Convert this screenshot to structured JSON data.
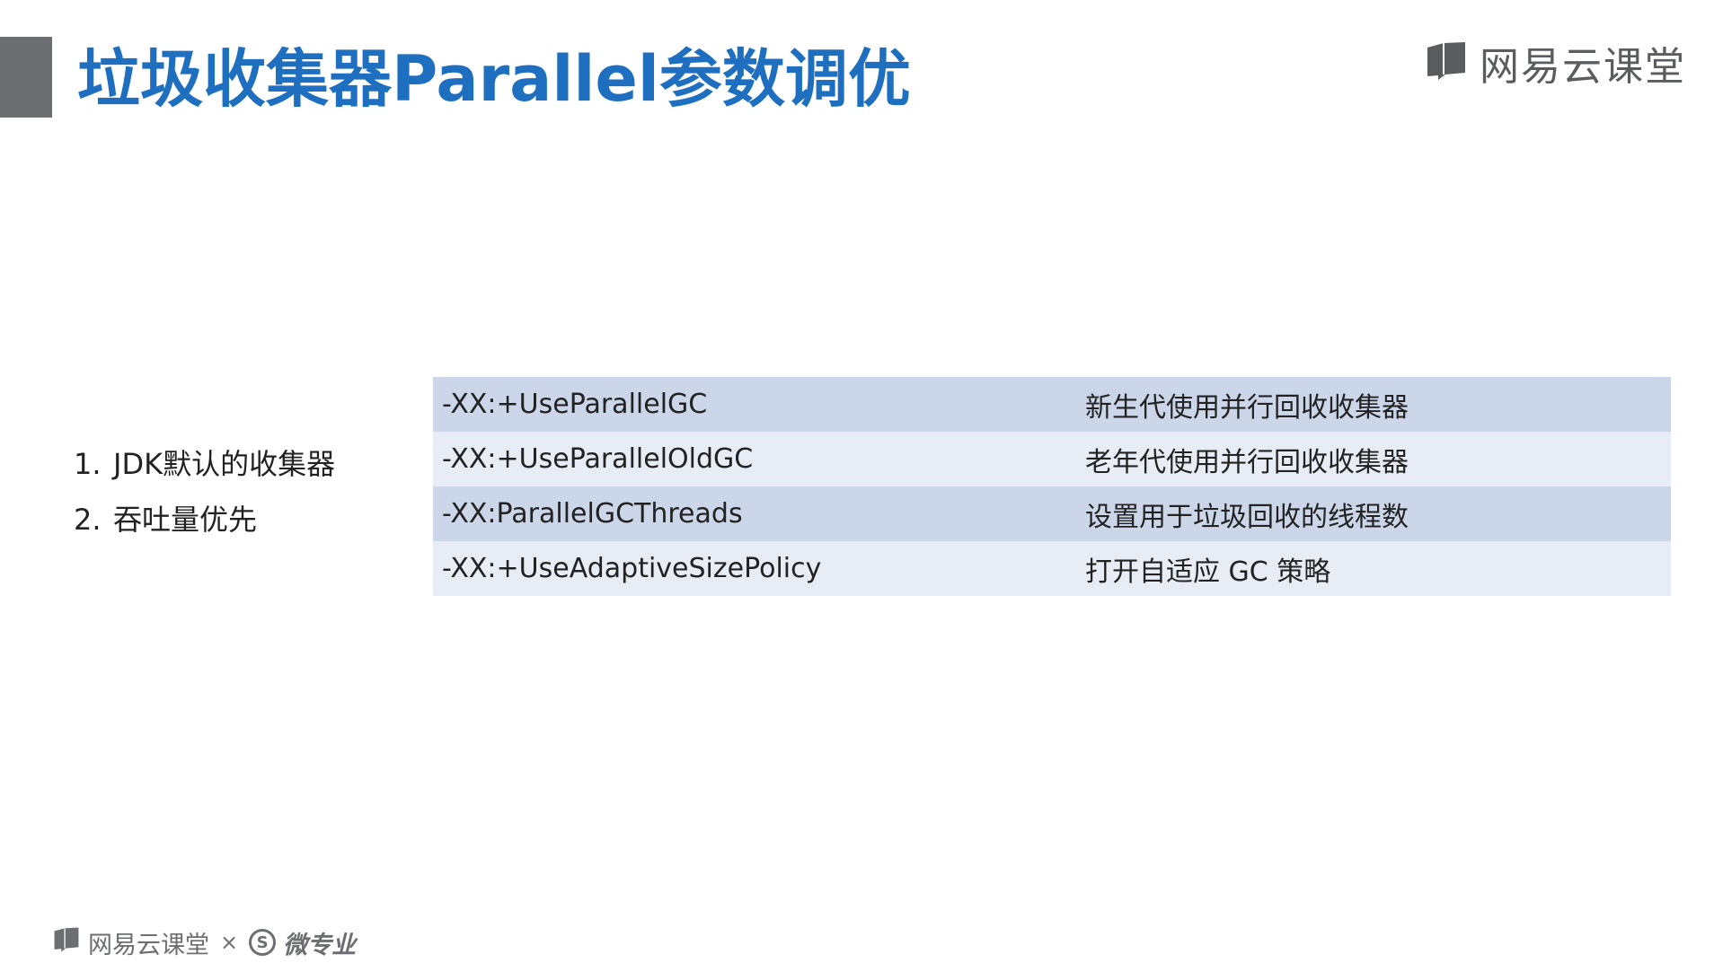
{
  "slide": {
    "title": "垃圾收集器Parallel参数调优"
  },
  "brand": {
    "name": "网易云课堂",
    "icon": "book-icon"
  },
  "bullets": [
    {
      "num": "1.",
      "text": "JDK默认的收集器"
    },
    {
      "num": "2.",
      "text": "吞吐量优先"
    }
  ],
  "params": [
    {
      "option": "-XX:+UseParallelGC",
      "desc": "新生代使用并行回收收集器"
    },
    {
      "option": "-XX:+UseParallelOldGC",
      "desc": "老年代使用并行回收收集器"
    },
    {
      "option": "-XX:ParallelGCThreads",
      "desc": "设置用于垃圾回收的线程数"
    },
    {
      "option": "-XX:+UseAdaptiveSizePolicy",
      "desc": "打开自适应 GC 策略"
    }
  ],
  "footer": {
    "brand": "网易云课堂",
    "times": "×",
    "s_logo": "S",
    "micro": "微专业"
  },
  "colors": {
    "title": "#1f6fc1",
    "block": "#6d6e72",
    "row_dark": "#ccd6e9",
    "row_light": "#e8ecf5"
  }
}
